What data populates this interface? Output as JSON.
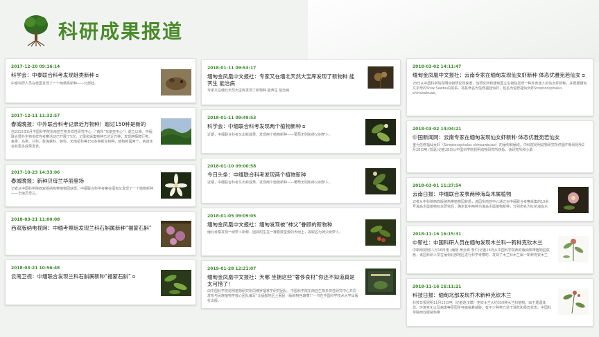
{
  "page": {
    "title": "科研成果报道"
  },
  "columns": [
    {
      "cards": [
        {
          "date": "2017-12-20 09:16:14",
          "headline": "科学会：中泰联合科考发现蛙类新种",
          "desc": "中泰科研人员在泰国发现了一个两栖类新种——北部蛙。",
          "thumb": "frog-photo"
        },
        {
          "date": "2017-12-11 11:32:57",
          "headline": "春城晚报：中外联合科考记录近万物种！超过150种是新的",
          "desc": "自2015年6月中国科学院东南亚生物多样性研究中心（“南所”东南亚中心”）成立以来，中缅联合野外生物多样性考察活动已开展了5次，记录和采集物种已达近万种，发现两栖爬行类、鱼类、鸟类、兰科、秋海棠科、蕨科、天南星科等150多种新生物种，植物新属两个，纳诺还会有更多成果发表。",
          "thumb": "forest-photo"
        },
        {
          "date": "2017-10-23 14:33:06",
          "headline": "春城晚报：新种贝母兰华丽登场",
          "desc": "记者从中国科学院西双版纳热带植物园获悉，中缅联合科学考察在缅甸又发现了一个植物新种——华丽贝母兰。",
          "thumb": "orchid-photo"
        },
        {
          "date": "2018-03-21 11:00:08",
          "headline": "西双版纳电视网：中缅考察组发现兰科石斛属新种“福蒙石斛”",
          "desc": "",
          "thumb": "purple-flower-photo"
        },
        {
          "date": "2018-03-21 10:56:48",
          "headline": "云南卫视：中缅联合发现兰科石斛属新种“福蒙石斛”",
          "desc": "",
          "thumb": "green-plant-photo"
        }
      ]
    },
    {
      "cards": [
        {
          "date": "2018-01-11 09:53:17",
          "headline": "缅甸金凤凰中文报社：专家又在缅北天然大宝库发现了新物种 能荠生 能治病",
          "desc": "专家又在缅北天然大宝库发现了新物种 能荠生 能治病",
          "thumb": "dark-plant-photo"
        },
        {
          "date": "2018-01-11 09:49:53",
          "headline": "科学会：中缅联合科考发现两个植物新种",
          "desc": "近期，中缅联合科考又出新成果，发现两个植物新种——葡萄无则和绯父树萝卜。",
          "thumb": "leaf-photo"
        },
        {
          "date": "2018-01-10 09:00:58",
          "headline": "今日头条：中缅联合科考发现两个植物新种",
          "desc": "近期，中缅联合科考又出新成果，发现两个植物新种——葡萄无则和绯父树萝卜。",
          "thumb": "leaf-photo-2"
        },
        {
          "date": "2018-01-05 09:09:05",
          "headline": "缅甸金凤凰中文报社：缅甸发现被“神父”眷顾的新物种",
          "desc": "缅北考察发现一树萝卜新种，因其附生在一棵着数堂旁的大树上，故取名为神父树萝卜。",
          "thumb": "berry-photo"
        },
        {
          "date": "2019-01-28 12:21:07",
          "headline": "缅甸金凤凰中文报社：天哪 坐拥这些“奢侈食材”你还不知道真是太可惜了！",
          "desc": "由中国科学院昆明植物研究所同佛罗福林学研究团队，中国科学院东南亚生物多样性研究中心共同发布与民族植物学核心团队编写“北缅部地区土著民（缅甸特色蔬菜）”一书在中国科学技术大学出版社出版。",
          "thumb": "book-cover"
        }
      ]
    },
    {
      "cards": [
        {
          "date": "2018-03-02 14:11:47",
          "headline": "缅甸金凤凰中文报社：云南专家在缅甸发现仙女虾新种 体态优雅宛若仙女",
          "desc": "28日从中国科学院昆明动物研究所获悉，该研究所和缅甸国立生物院发现一种外表迷人的仙女虾新种，并根据缅甸文字母的Shiw Sawbu的故事，将其命名为信修福娃仙虾，包名为信修福仙女虾Streptocephalus shinsawbuae。",
          "thumb": "none"
        },
        {
          "date": "2018-03-02 14:04:21",
          "headline": "中国新闻网：云南专家在缅甸发现仙女虾新种 体态优雅宛若仙女",
          "desc": "重为信修福仙女虾（Streptocephalus shinsawbuae）的缅甸和缅线。中科院昆明动物研究所供图中新网昆明2月28日电 (郭嘉)记者28日从中国科学院昆明动物研究所获悉，该研究所和小勇",
          "thumb": "none"
        },
        {
          "date": "2018-03-01 11:27:54",
          "headline": "云南日报：中缅联合发表两种海岛木属植物",
          "desc": "记者从中科院西双版纳热带植物园获悉，该园东南亚中心通过对中缅联合考察采集的10余号海岛木属植物标本研究后，确定其中两种为海岛木属植物新种，分别命名为红花海岛木",
          "thumb": "pink-flower-photo"
        },
        {
          "date": "2018-11-16 16:15:31",
          "headline": "中新社：中国科研人员在缅甸发现木兰科一新种克钦木兰",
          "desc": "中新网昆明11月16日电 (缅隔 黄云峰 李仁)记者16日从中国科学院西双版纳热带植物园获悉，该园科研人员在缅甸北部地区进行科学考察时，发现了木兰科木兰属一新种克钦木兰",
          "thumb": "illustration"
        },
        {
          "date": "2018-11-16 16:11:21",
          "headline": "科技日报：缅甸北部发现乔木新种克钦木兰",
          "desc": "科技日报昆明11月15日电（记者赵汉斌）克钦木兰大约350种木兰科植物，由于遭遇逢伐、环境变化以及病害等原因生存面临着威胁，有不少种类已处于濒危和极危状态。中国科学院西双版纳热带",
          "thumb": "illustration-2"
        }
      ]
    }
  ]
}
